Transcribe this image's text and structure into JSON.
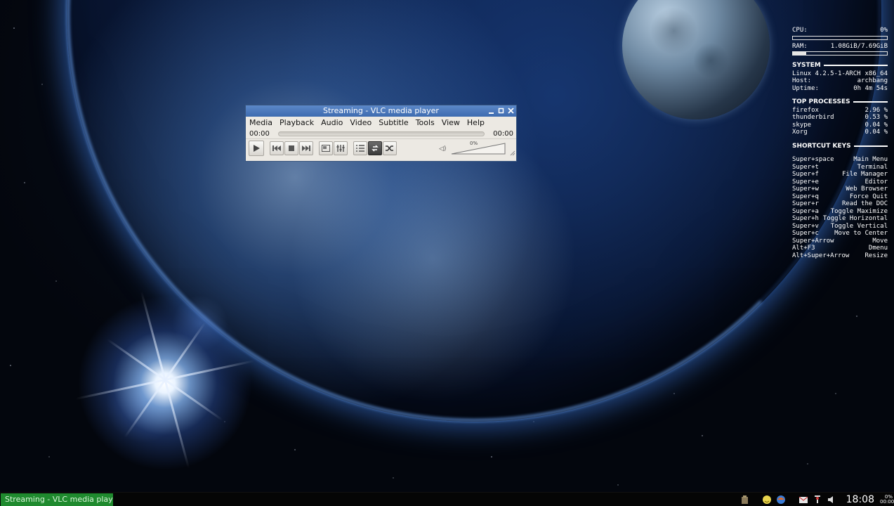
{
  "vlc": {
    "title": "Streaming - VLC media player",
    "menu": [
      "Media",
      "Playback",
      "Audio",
      "Video",
      "Subtitle",
      "Tools",
      "View",
      "Help"
    ],
    "time_elapsed": "00:00",
    "time_total": "00:00",
    "seek_progress": 0,
    "volume_label": "0%",
    "controls": [
      "play-icon",
      "previous-icon",
      "stop-icon",
      "next-icon",
      "fullscreen-icon",
      "extended-settings-icon",
      "playlist-icon",
      "loop-icon",
      "shuffle-icon"
    ]
  },
  "conky": {
    "cpu_label": "CPU:",
    "cpu_value": "0%",
    "cpu_fraction": 0.0,
    "ram_label": "RAM:",
    "ram_value": "1.08GiB/7.69GiB",
    "ram_fraction": 0.14,
    "system_header": "SYSTEM",
    "system": [
      {
        "k": "Linux 4.2.5-1-ARCH",
        "v": "x86_64"
      },
      {
        "k": "Host:",
        "v": "archbang"
      },
      {
        "k": "Uptime:",
        "v": "0h 4m 54s"
      }
    ],
    "processes_header": "TOP PROCESSES",
    "processes": [
      {
        "k": "firefox",
        "v": "2.96 %"
      },
      {
        "k": "thunderbird",
        "v": "0.53 %"
      },
      {
        "k": "skype",
        "v": "0.04 %"
      },
      {
        "k": "Xorg",
        "v": "0.04 %"
      }
    ],
    "shortcuts_header": "SHORTCUT KEYS",
    "shortcuts": [
      {
        "k": "Super+space",
        "v": "Main Menu"
      },
      {
        "k": "Super+t",
        "v": "Terminal"
      },
      {
        "k": "Super+f",
        "v": "File Manager"
      },
      {
        "k": "Super+e",
        "v": "Editor"
      },
      {
        "k": "Super+w",
        "v": "Web Browser"
      },
      {
        "k": "Super+q",
        "v": "Force Quit"
      },
      {
        "k": "Super+r",
        "v": "Read the DOC"
      },
      {
        "k": "Super+a",
        "v": "Toggle Maximize"
      },
      {
        "k": "Super+h",
        "v": "Toggle Horizontal"
      },
      {
        "k": "Super+v",
        "v": "Toggle Vertical"
      },
      {
        "k": "Super+c",
        "v": "Move to Center"
      },
      {
        "k": "Super+Arrow",
        "v": "Move"
      },
      {
        "k": "Alt+F3",
        "v": "Dmenu"
      },
      {
        "k": "Alt+Super+Arrow",
        "v": "Resize"
      }
    ]
  },
  "taskbar": {
    "task_label": "Streaming - VLC media player",
    "tray_icons": [
      "package-update-icon",
      "chat-icon",
      "browser-icon",
      "mail-icon",
      "network-icon",
      "volume-icon"
    ],
    "cpu_mini_value": "0%",
    "cpu_mini_time": "00:00",
    "clock": "18:08"
  },
  "colors": {
    "task_active": "#1f8a2e",
    "vlc_title": "#3d6bb0"
  }
}
